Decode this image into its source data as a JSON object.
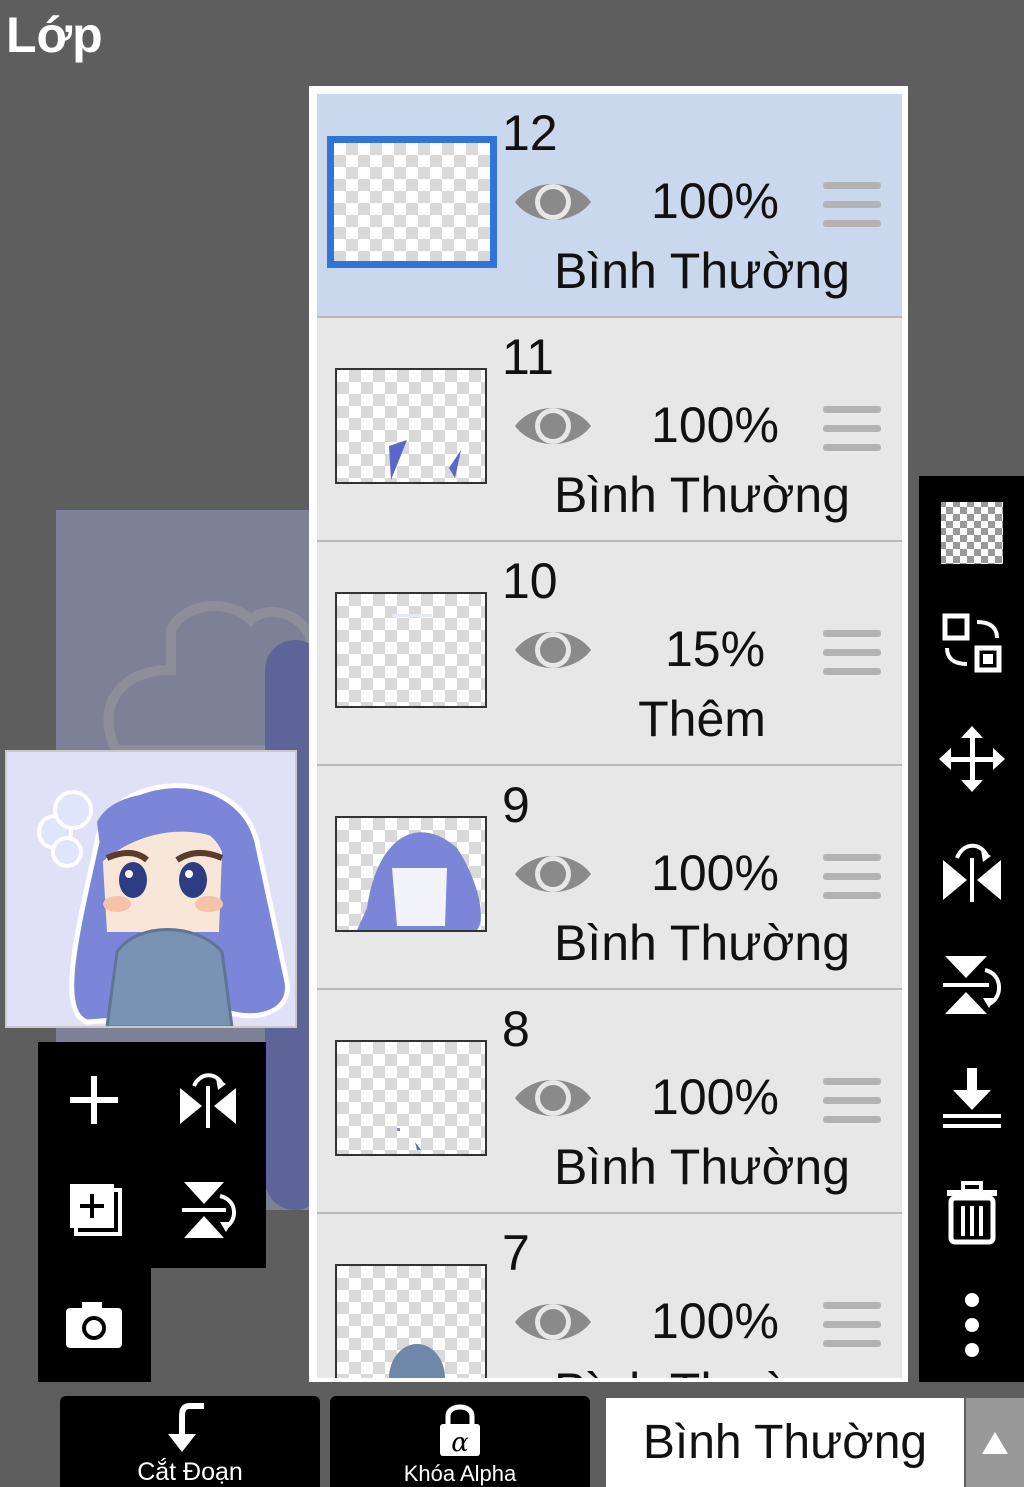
{
  "screen_title": "Lớp",
  "layers": [
    {
      "number": "12",
      "opacity": "100%",
      "blend": "Bình Thường",
      "selected": true
    },
    {
      "number": "11",
      "opacity": "100%",
      "blend": "Bình Thường",
      "selected": false
    },
    {
      "number": "10",
      "opacity": "15%",
      "blend": "Thêm",
      "selected": false
    },
    {
      "number": "9",
      "opacity": "100%",
      "blend": "Bình Thường",
      "selected": false
    },
    {
      "number": "8",
      "opacity": "100%",
      "blend": "Bình Thường",
      "selected": false
    },
    {
      "number": "7",
      "opacity": "100%",
      "blend": "Bình Thường",
      "selected": false
    }
  ],
  "bottom_bar": {
    "clip_label": "Cắt Đoạn",
    "alpha_lock_label": "Khóa Alpha",
    "blend_mode_value": "Bình Thường"
  },
  "colors": {
    "selected_layer_bg": "#c9d8ec",
    "selected_border": "#2f74d6",
    "hair": "#7b86d8"
  }
}
